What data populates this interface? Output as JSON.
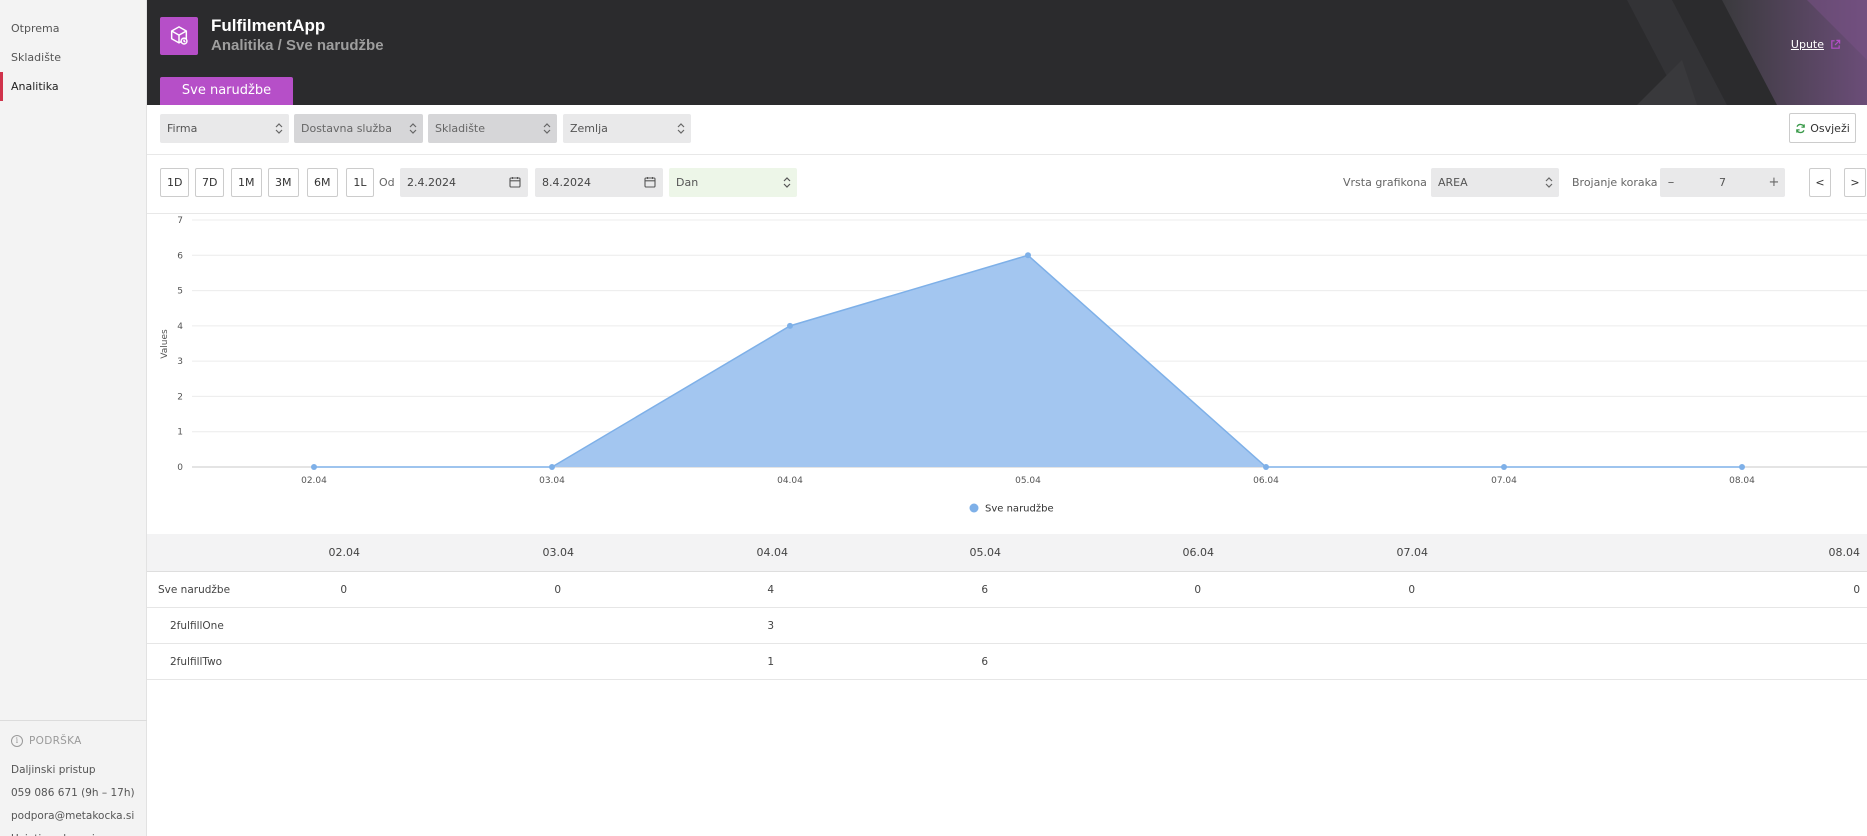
{
  "sidebar": {
    "items": [
      {
        "label": "Otprema"
      },
      {
        "label": "Skladište"
      },
      {
        "label": "Analitika"
      }
    ],
    "support": {
      "title": "PODRŠKA",
      "links": [
        "Daljinski pristup",
        "059 086 671 (9h – 17h)",
        "podpora@metakocka.si",
        "Uvjeti poslovanja"
      ]
    }
  },
  "header": {
    "app_title": "FulfilmentApp",
    "breadcrumb": "Analitika / Sve narudžbe",
    "help_link": "Upute",
    "tab": "Sve narudžbe"
  },
  "filters": {
    "firma": "Firma",
    "dostavna": "Dostavna služba",
    "skladiste": "Skladište",
    "zemlja": "Zemlja",
    "refresh": "Osvježi"
  },
  "toolbar": {
    "ranges": [
      "1D",
      "7D",
      "1M",
      "3M",
      "6M",
      "1L"
    ],
    "od_label": "Od",
    "date_from": "2.4.2024",
    "date_to": "8.4.2024",
    "granularity": "Dan",
    "chart_type_label": "Vrsta grafikona",
    "chart_type": "AREA",
    "steps_label": "Brojanje koraka",
    "steps_value": "7",
    "minus": "–",
    "plus": "+",
    "prev": "<",
    "next": ">"
  },
  "colors": {
    "accent": "#b64fc8",
    "header_bg": "#2b2b2d",
    "area_fill": "#a3c6f0",
    "area_stroke": "#7eb0e8",
    "active_marker": "#d0334b"
  },
  "chart_data": {
    "type": "area",
    "ylabel": "Values",
    "categories": [
      "02.04",
      "03.04",
      "04.04",
      "05.04",
      "06.04",
      "07.04",
      "08.04"
    ],
    "series": [
      {
        "name": "Sve narudžbe",
        "values": [
          0,
          0,
          4,
          6,
          0,
          0,
          0
        ]
      }
    ],
    "ylim": [
      0,
      7
    ],
    "yticks": [
      0,
      1,
      2,
      3,
      4,
      5,
      6,
      7
    ],
    "grid": true,
    "legend": "bottom-center"
  },
  "table": {
    "headers": [
      "02.04",
      "03.04",
      "04.04",
      "05.04",
      "06.04",
      "07.04",
      "08.04"
    ],
    "rows": [
      {
        "label": "Sve narudžbe",
        "values": [
          "0",
          "0",
          "4",
          "6",
          "0",
          "0",
          "0"
        ],
        "sub": false
      },
      {
        "label": "2fulfillOne",
        "values": [
          "",
          "",
          "3",
          "",
          "",
          "",
          ""
        ],
        "sub": true
      },
      {
        "label": "2fulfillTwo",
        "values": [
          "",
          "",
          "1",
          "6",
          "",
          "",
          ""
        ],
        "sub": true
      }
    ]
  }
}
